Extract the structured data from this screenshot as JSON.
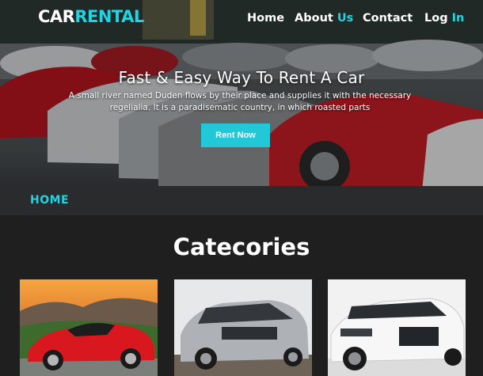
{
  "logo": {
    "part1": "CAR",
    "part2": "RENTAL"
  },
  "nav": {
    "home": "Home",
    "about_1": "About",
    "about_2": "Us",
    "contact": "Contact",
    "log_1": "Log",
    "log_2": "In"
  },
  "hero": {
    "title": "Fast & Easy Way To Rent A Car",
    "subtitle": "A small river named Duden flows by their place and supplies it with the necessary regelialia. It is a paradisematic country, in which roasted parts",
    "button": "Rent Now",
    "breadcrumb": "HOME"
  },
  "categories": {
    "title": "Catecories",
    "cards": [
      {
        "icon": "red-roadster-photo"
      },
      {
        "icon": "silver-suv-photo"
      },
      {
        "icon": "white-sedan-photo"
      }
    ]
  },
  "colors": {
    "accent": "#21d4e3",
    "button": "#22c8d7",
    "background": "#1f1f1f"
  }
}
